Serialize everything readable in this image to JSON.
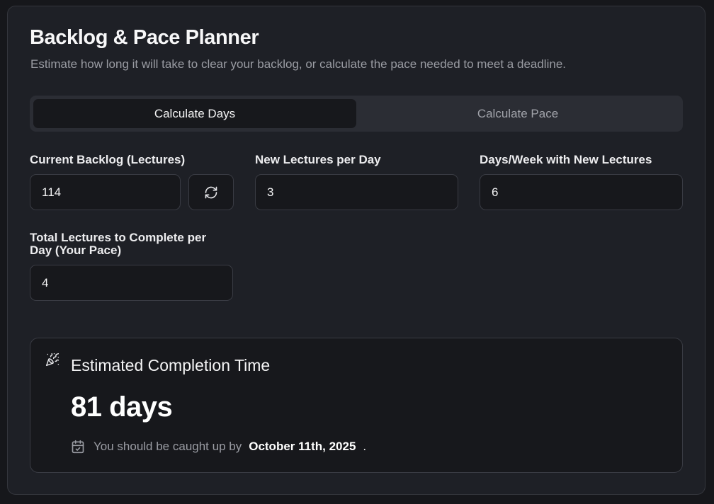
{
  "header": {
    "title": "Backlog & Pace Planner",
    "subtitle": "Estimate how long it will take to clear your backlog, or calculate the pace needed to meet a deadline."
  },
  "tabs": [
    {
      "label": "Calculate Days",
      "active": true
    },
    {
      "label": "Calculate Pace",
      "active": false
    }
  ],
  "fields": {
    "backlog": {
      "label": "Current Backlog (Lectures)",
      "value": "114"
    },
    "new_per_day": {
      "label": "New Lectures per Day",
      "value": "3"
    },
    "days_per_week": {
      "label": "Days/Week with New Lectures",
      "value": "6"
    },
    "pace": {
      "label_line1": "Total Lectures to Complete per",
      "label_line2": "Day (Your Pace)",
      "value": "4"
    }
  },
  "reset_icon": "refresh-icon",
  "result": {
    "icon": "party-popper-icon",
    "title": "Estimated Completion Time",
    "value": "81 days",
    "note_icon": "calendar-check-icon",
    "note_prefix": "You should be caught up by",
    "note_date": "October 11th, 2025",
    "note_suffix": "."
  }
}
